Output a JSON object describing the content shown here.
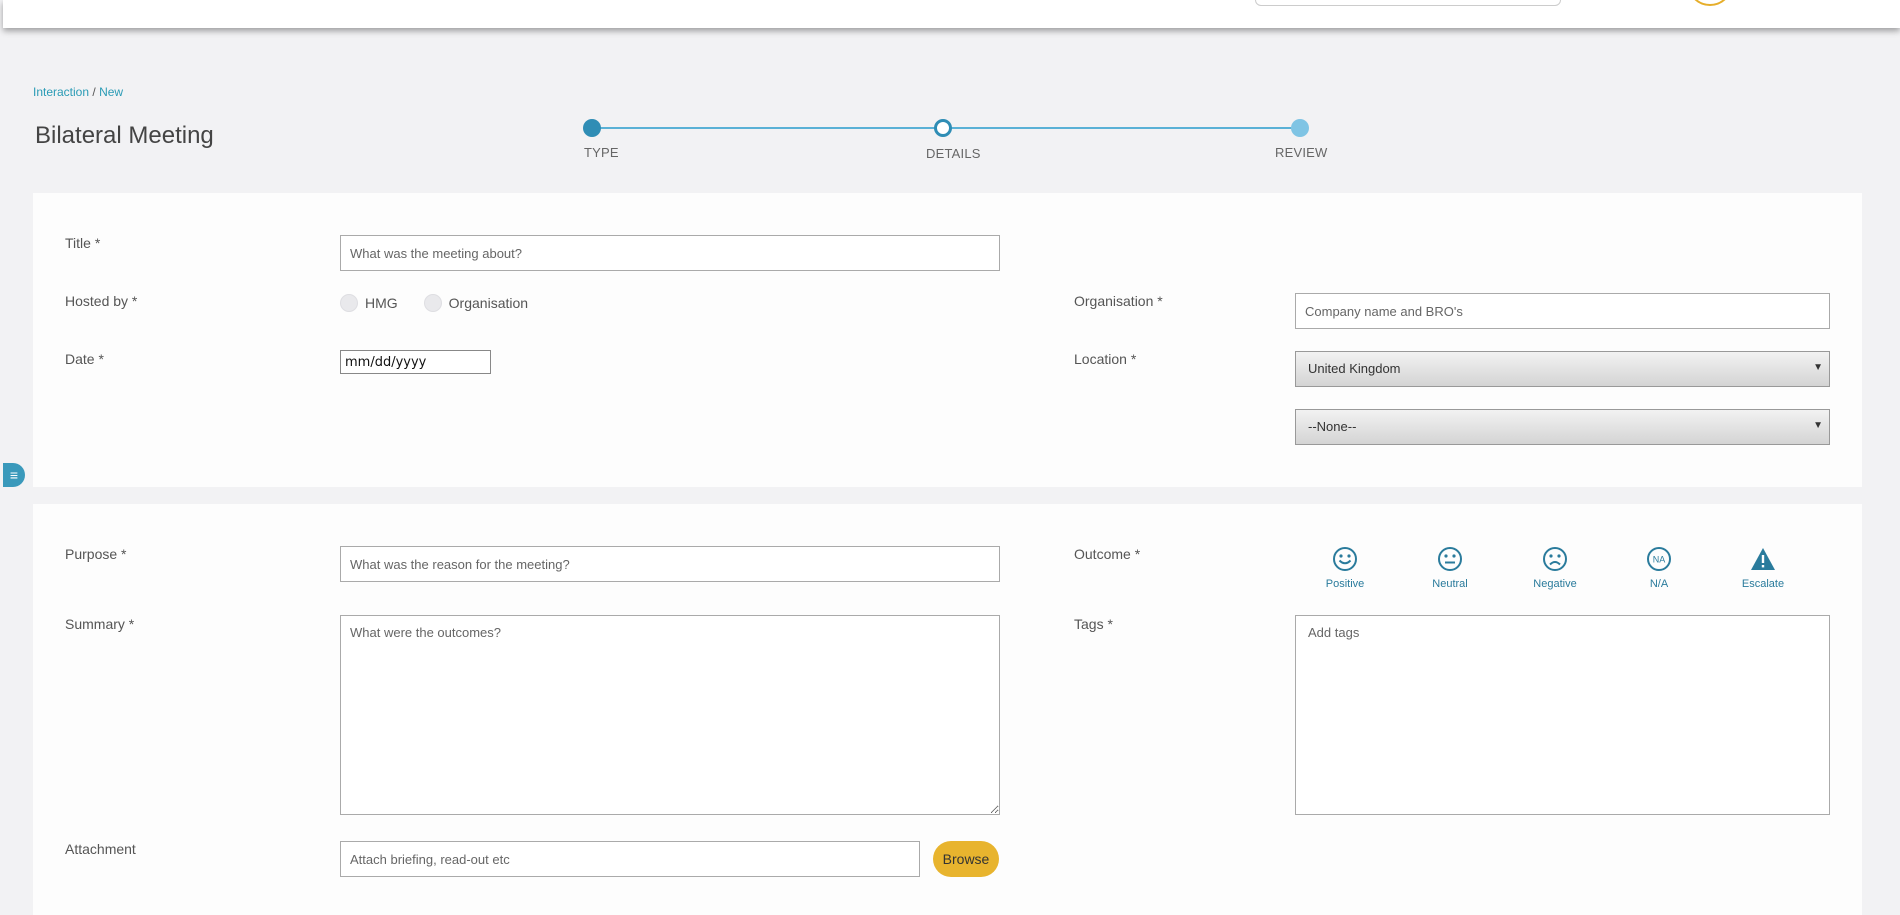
{
  "breadcrumb": {
    "root": "Interaction",
    "sep": "/",
    "current": "New"
  },
  "page_title": "Bilateral Meeting",
  "stepper": {
    "steps": [
      "TYPE",
      "DETAILS",
      "REVIEW"
    ]
  },
  "section1": {
    "title_label": "Title *",
    "title_placeholder": "What was the meeting about?",
    "hosted_label": "Hosted by *",
    "hosted_options": [
      "HMG",
      "Organisation"
    ],
    "date_label": "Date *",
    "date_value": "mm/dd/yyyy",
    "organisation_label": "Organisation *",
    "organisation_placeholder": "Company name and BRO's",
    "location_label": "Location *",
    "location_value": "United Kingdom",
    "sublocation_value": "--None--"
  },
  "section2": {
    "purpose_label": "Purpose *",
    "purpose_placeholder": "What was the reason for the meeting?",
    "summary_label": "Summary *",
    "summary_placeholder": "What were the outcomes?",
    "attachment_label": "Attachment",
    "attachment_placeholder": "Attach briefing, read-out etc",
    "browse_label": "Browse",
    "outcome_label": "Outcome *",
    "outcomes": [
      {
        "label": "Positive",
        "icon": "smile-icon"
      },
      {
        "label": "Neutral",
        "icon": "neutral-face-icon"
      },
      {
        "label": "Negative",
        "icon": "frown-icon"
      },
      {
        "label": "N/A",
        "icon": "na-icon",
        "glyph": "NA"
      },
      {
        "label": "Escalate",
        "icon": "warning-icon"
      }
    ],
    "tags_label": "Tags *",
    "tags_placeholder": "Add tags"
  },
  "colors": {
    "accent": "#2a9bb5",
    "stepper": "#2f8db5",
    "browse": "#e8b42e",
    "avatar_ring": "#e6ae2a"
  }
}
